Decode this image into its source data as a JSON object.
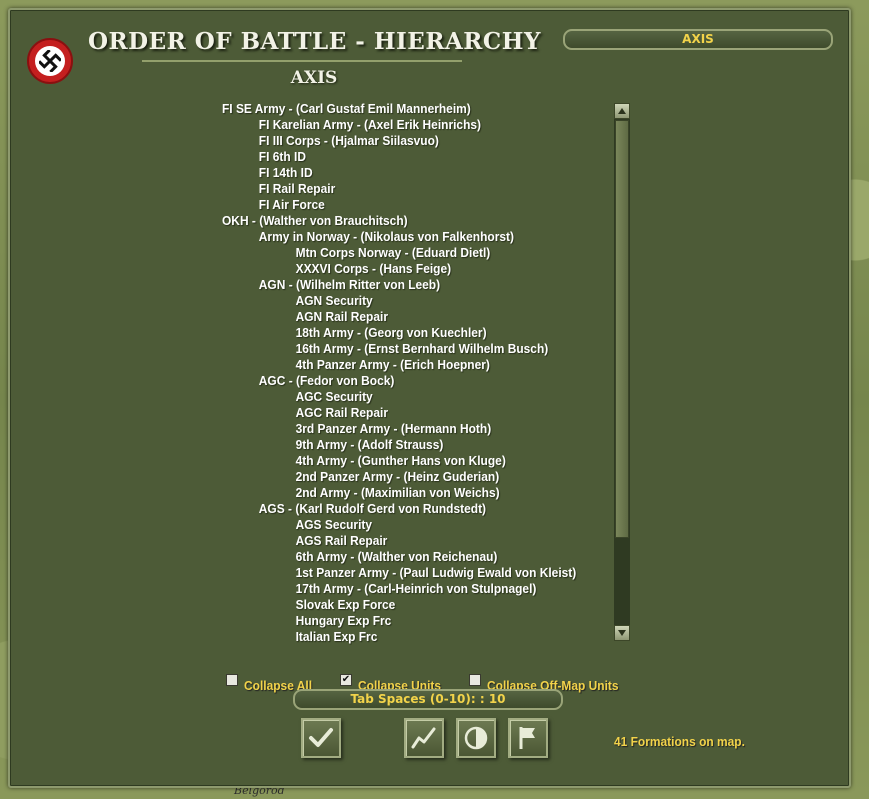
{
  "window": {
    "title": "ORDER OF BATTLE - HIERARCHY",
    "side_heading": "AXIS",
    "side_selector": "AXIS"
  },
  "map": {
    "labels": [
      "Belgorod"
    ]
  },
  "hierarchy": [
    {
      "level": 0,
      "text": "FI SE Army - (Carl Gustaf Emil Mannerheim)"
    },
    {
      "level": 1,
      "text": "FI Karelian Army - (Axel Erik Heinrichs)"
    },
    {
      "level": 1,
      "text": "FI III Corps - (Hjalmar Siilasvuo)"
    },
    {
      "level": 1,
      "text": "FI 6th ID"
    },
    {
      "level": 1,
      "text": "FI 14th ID"
    },
    {
      "level": 1,
      "text": "FI Rail Repair"
    },
    {
      "level": 1,
      "text": "FI Air Force"
    },
    {
      "level": 0,
      "text": "OKH - (Walther von Brauchitsch)"
    },
    {
      "level": 1,
      "text": "Army in Norway - (Nikolaus von Falkenhorst)"
    },
    {
      "level": 2,
      "text": "Mtn Corps Norway - (Eduard Dietl)"
    },
    {
      "level": 2,
      "text": "XXXVI Corps - (Hans Feige)"
    },
    {
      "level": 1,
      "text": "AGN - (Wilhelm Ritter von Leeb)"
    },
    {
      "level": 2,
      "text": "AGN Security"
    },
    {
      "level": 2,
      "text": "AGN Rail Repair"
    },
    {
      "level": 2,
      "text": "18th Army - (Georg von Kuechler)"
    },
    {
      "level": 2,
      "text": "16th Army - (Ernst Bernhard Wilhelm Busch)"
    },
    {
      "level": 2,
      "text": "4th Panzer Army - (Erich Hoepner)"
    },
    {
      "level": 1,
      "text": "AGC - (Fedor von Bock)"
    },
    {
      "level": 2,
      "text": "AGC Security"
    },
    {
      "level": 2,
      "text": "AGC Rail Repair"
    },
    {
      "level": 2,
      "text": "3rd Panzer Army - (Hermann Hoth)"
    },
    {
      "level": 2,
      "text": "9th Army - (Adolf Strauss)"
    },
    {
      "level": 2,
      "text": "4th Army - (Gunther Hans von Kluge)"
    },
    {
      "level": 2,
      "text": "2nd Panzer Army - (Heinz Guderian)"
    },
    {
      "level": 2,
      "text": "2nd Army - (Maximilian von Weichs)"
    },
    {
      "level": 1,
      "text": "AGS - (Karl Rudolf Gerd von Rundstedt)"
    },
    {
      "level": 2,
      "text": "AGS Security"
    },
    {
      "level": 2,
      "text": "AGS Rail Repair"
    },
    {
      "level": 2,
      "text": "6th Army - (Walther von Reichenau)"
    },
    {
      "level": 2,
      "text": "1st Panzer Army - (Paul Ludwig Ewald von Kleist)"
    },
    {
      "level": 2,
      "text": "17th Army - (Carl-Heinrich von Stulpnagel)"
    },
    {
      "level": 2,
      "text": "Slovak Exp Force"
    },
    {
      "level": 2,
      "text": "Hungary Exp Frc"
    },
    {
      "level": 2,
      "text": "Italian Exp Frc"
    }
  ],
  "options": {
    "collapse_all": {
      "label": "Collapse All",
      "checked": false
    },
    "collapse_units": {
      "label": "Collapse Units",
      "checked": true
    },
    "collapse_offmap": {
      "label": "Collapse Off-Map Units",
      "checked": false
    },
    "tab_spaces": "Tab Spaces (0-10): : 10"
  },
  "buttons": {
    "confirm": "check-icon",
    "graph": "line-graph-icon",
    "contrast": "half-circle-icon",
    "flag": "flag-icon"
  },
  "status": {
    "formations": "41 Formations on map."
  },
  "colors": {
    "panel": "#4d5b37",
    "accent_text": "#f2d34a",
    "emblem_red": "#c41f1f"
  }
}
